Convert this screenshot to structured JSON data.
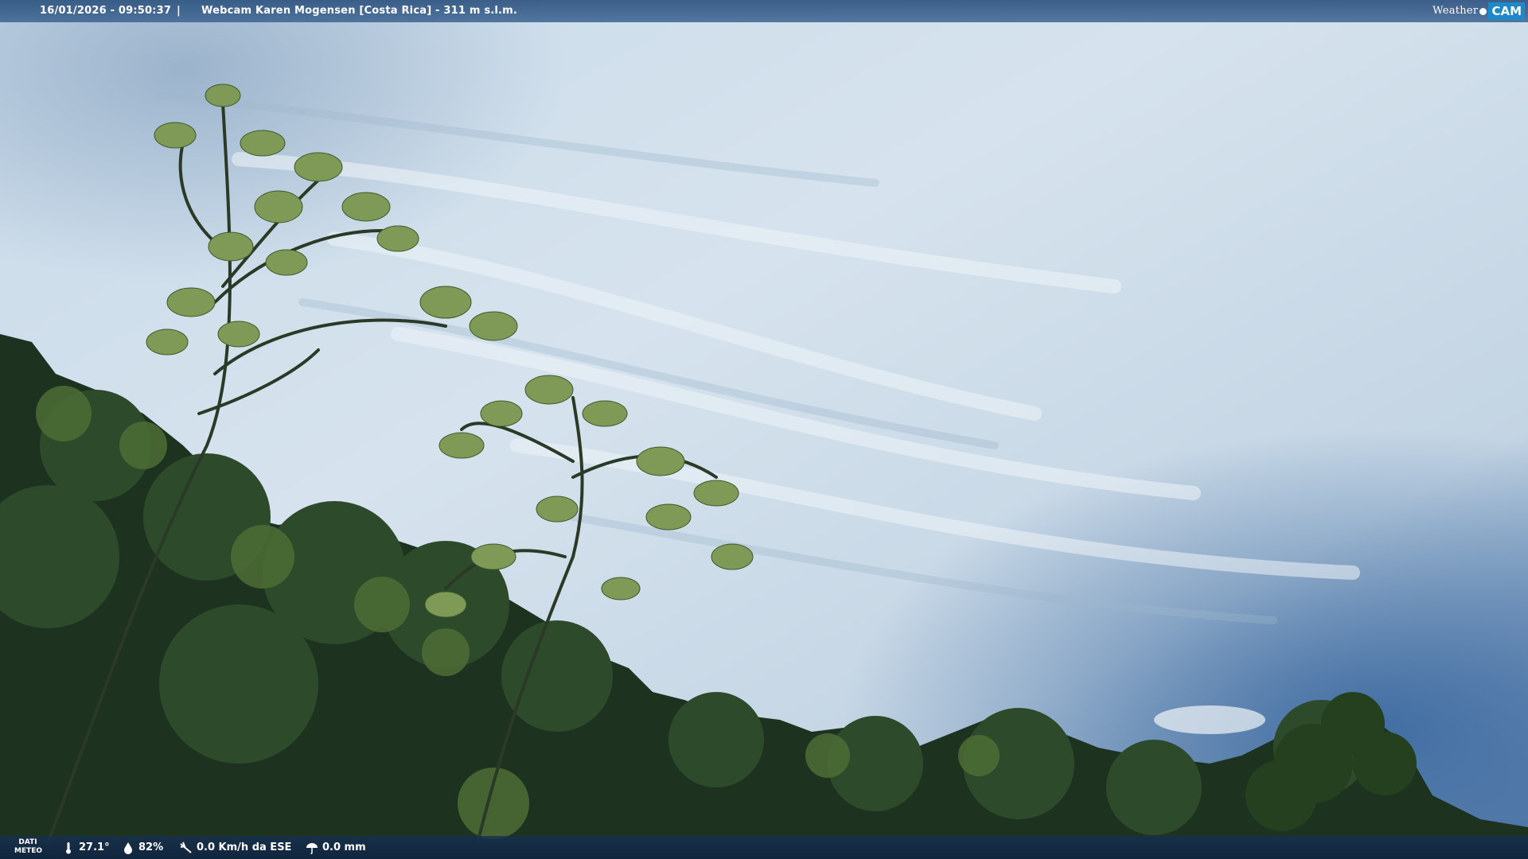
{
  "header": {
    "timestamp": "16/01/2026 - 09:50:37",
    "separator": "|",
    "title": "Webcam Karen Mogensen [Costa Rica] - 311 m s.l.m."
  },
  "logo": {
    "left_text": "Weather",
    "right_text": "CAM",
    "accent_color": "#1e88c9"
  },
  "meteo_bar": {
    "label": "DATI\nMETEO",
    "temperature": "27.1°",
    "humidity": "82%",
    "wind": "0.0 Km/h da ESE",
    "rain": "0.0 mm",
    "icons": [
      "thermometer-icon",
      "humidity-drop-icon",
      "wind-icon",
      "rain-icon"
    ]
  },
  "scene": {
    "description_colors": {
      "sky_light": "#d3e2ee",
      "sky_dark": "#3f6a9c",
      "foliage_dark": "#1a2f19",
      "foliage_mid": "#3c5a2c",
      "foliage_light": "#8ea565"
    }
  }
}
